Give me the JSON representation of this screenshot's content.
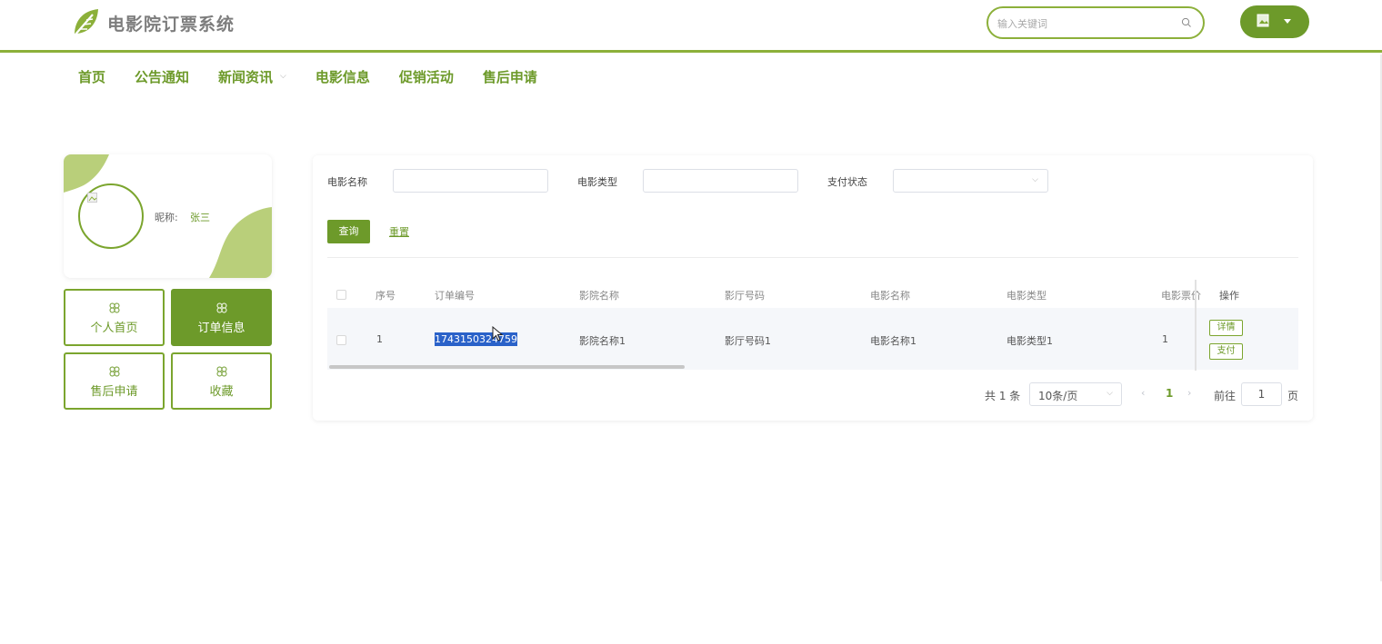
{
  "header": {
    "title": "电影院订票系统",
    "search_placeholder": "输入关键词",
    "logo_icon": "leaf-logo-icon",
    "user_menu_icon": "avatar-caret-icon"
  },
  "nav": {
    "items": [
      {
        "label": "首页"
      },
      {
        "label": "公告通知"
      },
      {
        "label": "新闻资讯",
        "has_dropdown": true
      },
      {
        "label": "电影信息"
      },
      {
        "label": "促销活动"
      },
      {
        "label": "售后申请"
      }
    ]
  },
  "profile": {
    "nickname_label": "昵称:",
    "nickname_value": "张三"
  },
  "side_menu": [
    {
      "label": "个人首页",
      "active": false
    },
    {
      "label": "订单信息",
      "active": true
    },
    {
      "label": "售后申请",
      "active": false
    },
    {
      "label": "收藏",
      "active": false
    }
  ],
  "filters": {
    "movie_name_label": "电影名称",
    "movie_type_label": "电影类型",
    "pay_status_label": "支付状态",
    "query_button": "查询",
    "reset_button": "重置"
  },
  "table": {
    "headers": [
      "序号",
      "订单编号",
      "影院名称",
      "影厅号码",
      "电影名称",
      "电影类型",
      "电影票价",
      "操作"
    ],
    "rows": [
      {
        "index": "1",
        "order_no": "1743150324759",
        "cinema": "影院名称1",
        "hall": "影厅号码1",
        "movie": "电影名称1",
        "type": "电影类型1",
        "price": "1",
        "actions": [
          "详情",
          "支付"
        ]
      }
    ]
  },
  "pagination": {
    "total": "共 1 条",
    "page_size": "10条/页",
    "current": "1",
    "goto_label": "前往",
    "goto_value": "1",
    "page_unit": "页"
  },
  "colors": {
    "accent": "#6d9a2a",
    "accent_light": "#8cb03a",
    "selection": "#2a62c9"
  }
}
